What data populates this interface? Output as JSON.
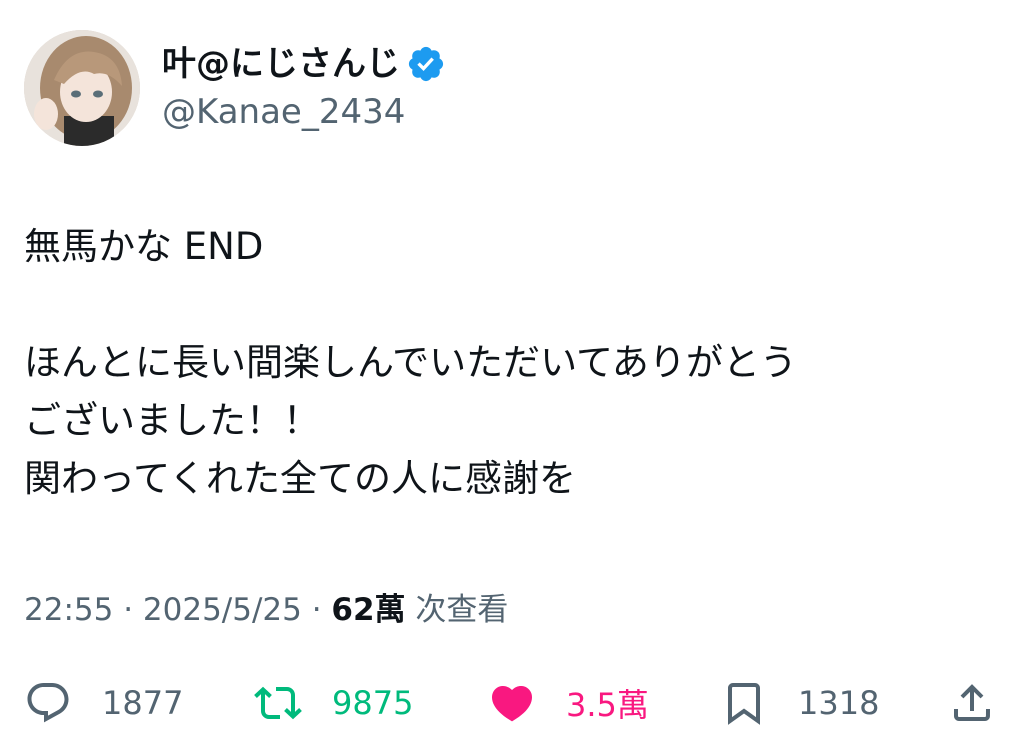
{
  "author": {
    "display_name": "叶@にじさんじ",
    "handle": "@Kanae_2434",
    "verified_color": "#1d9bf0"
  },
  "tweet": {
    "lines": [
      "無馬かな END",
      "",
      "ほんとに長い間楽しんでいただいてありがとう",
      "ございました！！",
      "関わってくれた全ての人に感謝を"
    ]
  },
  "meta": {
    "time": "22:55",
    "separator1": " · ",
    "date": "2025/5/25",
    "separator2": " · ",
    "views_count": "62萬",
    "views_label": " 次查看"
  },
  "actions": {
    "reply": {
      "icon": "reply-icon",
      "count": "1877"
    },
    "retweet": {
      "icon": "retweet-icon",
      "count": "9875",
      "color": "#00ba7c"
    },
    "like": {
      "icon": "heart-icon",
      "count": "3.5萬",
      "color": "#f91880"
    },
    "bookmark": {
      "icon": "bookmark-icon",
      "count": "1318"
    },
    "share": {
      "icon": "share-icon"
    }
  }
}
